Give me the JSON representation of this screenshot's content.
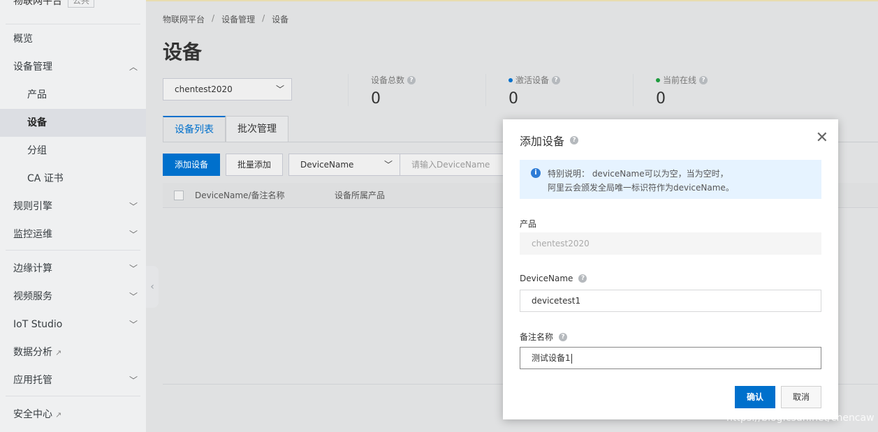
{
  "sidebar": {
    "brand": "物联网平台",
    "brand_tag": "公共",
    "items": [
      {
        "label": "概览"
      },
      {
        "label": "设备管理"
      },
      {
        "label": "产品"
      },
      {
        "label": "设备"
      },
      {
        "label": "分组"
      },
      {
        "label": "CA 证书"
      },
      {
        "label": "规则引擎"
      },
      {
        "label": "监控运维"
      },
      {
        "label": "边缘计算"
      },
      {
        "label": "视频服务"
      },
      {
        "label": "IoT Studio"
      },
      {
        "label": "数据分析"
      },
      {
        "label": "应用托管"
      },
      {
        "label": "安全中心"
      }
    ],
    "collapse_glyph": "‹"
  },
  "breadcrumb": [
    "物联网平台",
    "设备管理",
    "设备"
  ],
  "breadcrumb_sep": "/",
  "page_title": "设备",
  "product_select": {
    "value": "chentest2020"
  },
  "stats": [
    {
      "label": "设备总数",
      "value": "0",
      "dot_color": ""
    },
    {
      "label": "激活设备",
      "value": "0",
      "dot_color": "#0070cc"
    },
    {
      "label": "当前在线",
      "value": "0",
      "dot_color": "#1e9b3e"
    }
  ],
  "tabs": [
    {
      "label": "设备列表",
      "active": true
    },
    {
      "label": "批次管理",
      "active": false
    }
  ],
  "toolbar": {
    "add_label": "添加设备",
    "batch_label": "批量添加",
    "filter_value": "DeviceName",
    "search_placeholder": "请输入DeviceName"
  },
  "table": {
    "columns": [
      "DeviceName/备注名称",
      "设备所属产品"
    ]
  },
  "modal": {
    "title": "添加设备",
    "notice_line1": "特别说明： deviceName可以为空，当为空时，",
    "notice_line2": "阿里云会颁发全局唯一标识符作为deviceName。",
    "product_label": "产品",
    "product_value": "chentest2020",
    "devicename_label": "DeviceName",
    "devicename_value": "devicetest1",
    "nickname_label": "备注名称",
    "nickname_value": "测试设备1",
    "ok_label": "确认",
    "cancel_label": "取消",
    "close_glyph": "✕"
  },
  "watermark": "https://blog.csdn.net/chencaw",
  "colors": {
    "primary": "#0070cc",
    "online": "#1e9b3e"
  }
}
